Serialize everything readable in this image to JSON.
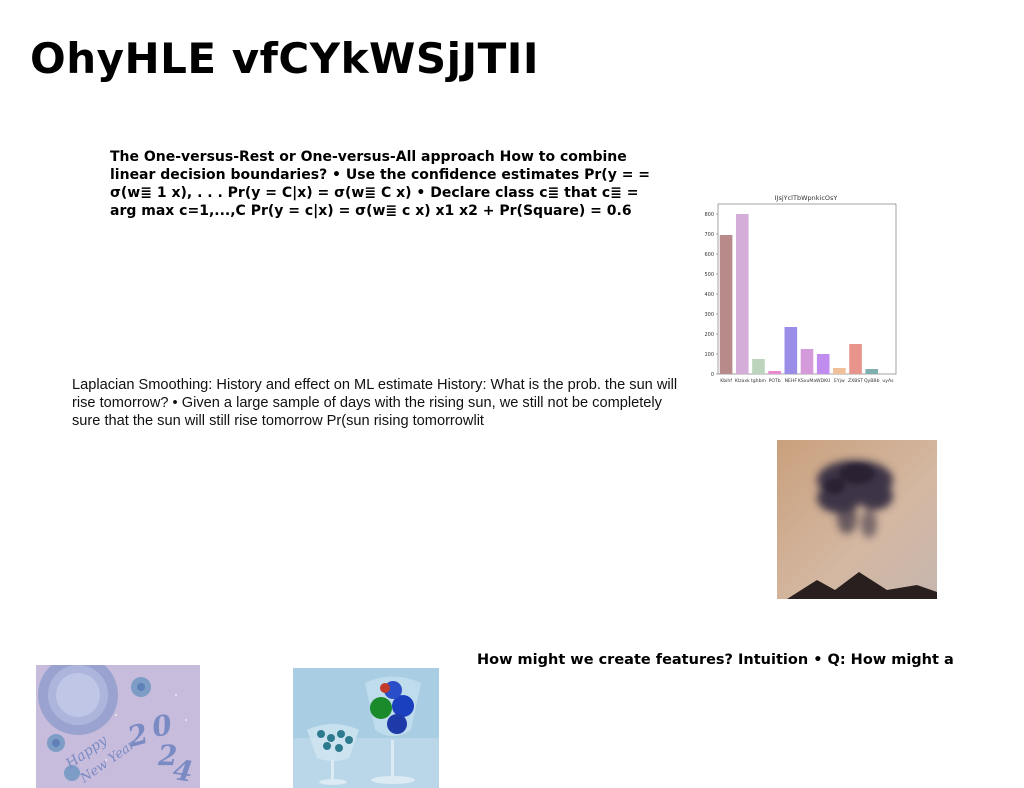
{
  "slide": {
    "title": "OhyHLE vfCYkWSjJTII",
    "block1": "The One-versus-Rest or One-versus-All approach How to combine linear decision boundaries? • Use the confidence estimates Pr(y = = σ(w≣ 1 x), . . . Pr(y = C|x) = σ(w≣ C x) • Declare class c≣ that c≣ = arg max c=1,...,C Pr(y = c|x) = σ(w≣ c x) x1 x2 + Pr(Square) = 0.6",
    "block2": "Laplacian Smoothing: History and effect on ML estimate History: What is the prob. the sun will rise tomorrow? • Given a large sample of days with the rising sun, we still not be completely sure that the sun will still rise tomorrow Pr(sun rising tomorrowlit",
    "block3": "How might we create features? Intuition • Q: How might a"
  },
  "chart_data": {
    "type": "bar",
    "title": "IJsjYclTbWpnkicOsY",
    "categories": [
      "Kbihf",
      "Klzaxk",
      "tghbm",
      "POTb",
      "NEHF",
      "KSxuMa",
      "WDKU",
      "EYjw",
      "ZXBST",
      "QyBBb",
      "uyAs"
    ],
    "values": [
      695,
      800,
      75,
      15,
      235,
      125,
      100,
      30,
      150,
      25
    ],
    "colors": [
      "#b98a8a",
      "#d4aed8",
      "#bcd4bc",
      "#e98ad0",
      "#9a8de8",
      "#d59ad9",
      "#c08cf0",
      "#f0c09a",
      "#e8948c",
      "#7fb0b0"
    ],
    "yticks": [
      0,
      100,
      200,
      300,
      400,
      500,
      600,
      700,
      800
    ],
    "ylim": [
      0,
      850
    ]
  }
}
